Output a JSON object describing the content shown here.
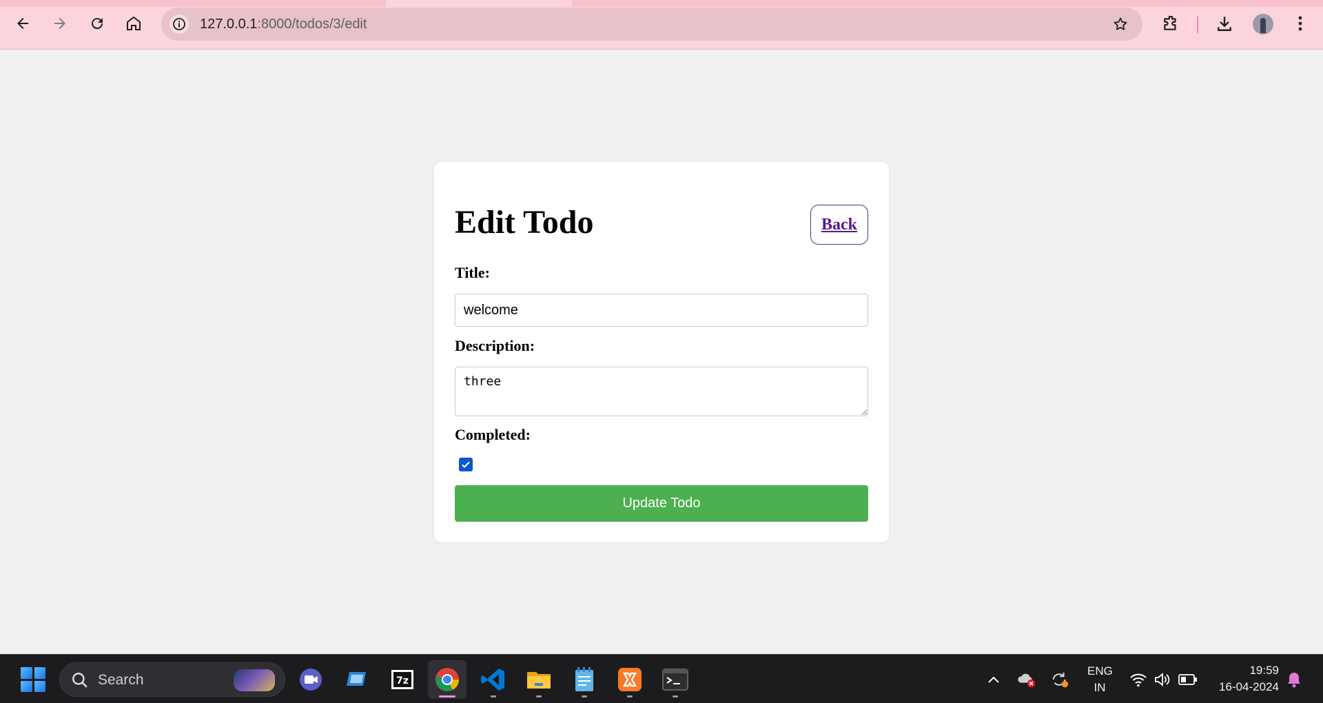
{
  "browser": {
    "url_host": "127.0.0.1",
    "url_path": ":8000/todos/3/edit"
  },
  "page": {
    "heading": "Edit Todo",
    "back_label": "Back",
    "title_label": "Title:",
    "title_value": "welcome",
    "description_label": "Description:",
    "description_value": "three",
    "completed_label": "Completed:",
    "completed_checked": true,
    "submit_label": "Update Todo"
  },
  "taskbar": {
    "search_placeholder": "Search",
    "apps": [
      "teams-icon",
      "remote-desktop-icon",
      "7zip-icon",
      "chrome-icon",
      "vscode-icon",
      "file-explorer-icon",
      "notepad-icon",
      "xampp-icon",
      "terminal-icon"
    ],
    "language_line1": "ENG",
    "language_line2": "IN",
    "time": "19:59",
    "date": "16-04-2024"
  },
  "colors": {
    "chrome_bg": "#fcd4dc",
    "omnibox_bg": "#e8c2c9",
    "page_bg": "#f0f0f0",
    "submit_bg": "#4caf50",
    "back_border": "#5b2a86",
    "taskbar_bg": "#1c1c1f"
  }
}
